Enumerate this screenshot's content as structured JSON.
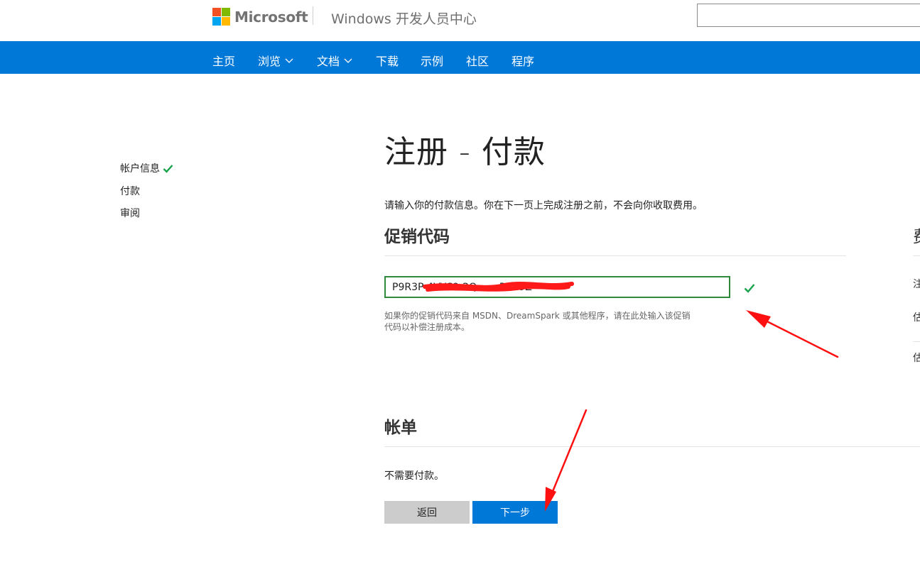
{
  "header": {
    "brand": "Microsoft",
    "site_title": "Windows 开发人员中心",
    "search": {
      "value": "",
      "placeholder": ""
    }
  },
  "nav": {
    "items": [
      {
        "label": "主页",
        "has_dropdown": false
      },
      {
        "label": "浏览",
        "has_dropdown": true
      },
      {
        "label": "文档",
        "has_dropdown": true
      },
      {
        "label": "下载",
        "has_dropdown": false
      },
      {
        "label": "示例",
        "has_dropdown": false
      },
      {
        "label": "社区",
        "has_dropdown": false
      },
      {
        "label": "程序",
        "has_dropdown": false
      }
    ]
  },
  "steps": [
    {
      "label": "帐户信息",
      "completed": true
    },
    {
      "label": "付款",
      "completed": false
    },
    {
      "label": "审阅",
      "completed": false
    }
  ],
  "main": {
    "title": "注册 - 付款",
    "intro": "请输入你的付款信息。你在下一页上完成注册之前，不会向你收取费用。",
    "promo": {
      "heading": "促销代码",
      "value": "P9R3P-4VYC9-2Q      -R329Z",
      "help": "如果你的促销代码来自 MSDN、DreamSpark 或其他程序，请在此处输入该促销代码以补偿注册成本。"
    },
    "billing": {
      "heading": "帐单",
      "no_payment": "不需要付款。"
    },
    "buttons": {
      "back": "返回",
      "next": "下一步"
    }
  },
  "right_column": {
    "fragments": [
      "费",
      "注",
      "估",
      "估"
    ]
  },
  "colors": {
    "accent": "#0078d7",
    "success": "#16a34a",
    "annotation": "#ff0000"
  }
}
